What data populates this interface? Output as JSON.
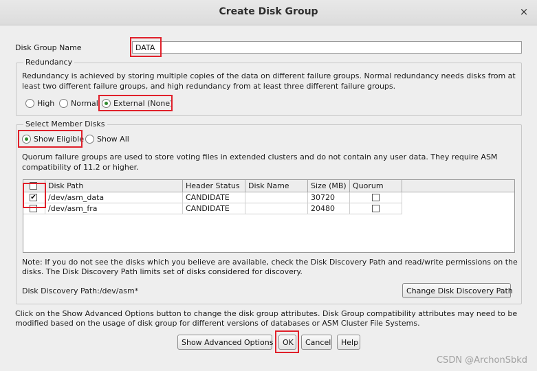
{
  "window": {
    "title": "Create Disk Group",
    "close": "×"
  },
  "disk_group_name": {
    "label": "Disk Group Name",
    "value": "DATA"
  },
  "redundancy": {
    "legend": "Redundancy",
    "description_line1": "Redundancy is achieved by storing multiple copies of the data on different failure groups. Normal redundancy needs disks from at",
    "description_line2": "least two different failure groups, and high redundancy from at least three different failure groups.",
    "options": [
      "High",
      "Normal",
      "External (None)"
    ],
    "selected": "External (None)"
  },
  "member_disks": {
    "legend": "Select Member Disks",
    "filter_options": [
      "Show Eligible",
      "Show All"
    ],
    "selected": "Show Eligible",
    "quorum_note_line1": "Quorum failure groups are used to store voting files in extended clusters and do not contain any user data. They require ASM",
    "quorum_note_line2": "compatibility of 11.2 or higher.",
    "table": {
      "columns": [
        "Disk Path",
        "Header Status",
        "Disk Name",
        "Size (MB)",
        "Quorum"
      ],
      "rows": [
        {
          "checked": true,
          "path": "/dev/asm_data",
          "status": "CANDIDATE",
          "name": "",
          "size": "30720",
          "quorum": false
        },
        {
          "checked": false,
          "path": "/dev/asm_fra",
          "status": "CANDIDATE",
          "name": "",
          "size": "20480",
          "quorum": false
        }
      ]
    },
    "note_line1": "Note: If you do not see the disks which you believe are available, check the Disk Discovery Path and read/write permissions on the",
    "note_line2": "disks. The Disk Discovery Path limits set of disks considered for discovery.",
    "discovery_path": "Disk Discovery Path:/dev/asm*",
    "change_path_button": "Change Disk Discovery Path"
  },
  "footer_note_line1": "Click on the Show Advanced Options button to change the disk group attributes. Disk Group compatibility attributes may need to be",
  "footer_note_line2": "modified based on the usage of disk group for different versions of databases or ASM Cluster File Systems.",
  "buttons": {
    "advanced": "Show Advanced Options",
    "ok": "OK",
    "cancel": "Cancel",
    "help": "Help"
  },
  "watermark": "CSDN @ArchonSbkd",
  "colors": {
    "highlight": "#e0202a",
    "radio_selected": "#2f8a2f"
  }
}
